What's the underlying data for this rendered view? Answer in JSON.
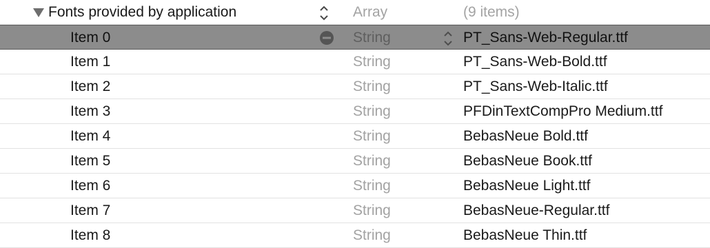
{
  "header": {
    "key": "Fonts provided by application",
    "type": "Array",
    "value": "(9 items)",
    "disclosure_icon": "disclosure-triangle-expanded",
    "stepper_icon": "up-down-chevron"
  },
  "items": [
    {
      "key": "Item 0",
      "type": "String",
      "value": "PT_Sans-Web-Regular.ttf"
    },
    {
      "key": "Item 1",
      "type": "String",
      "value": "PT_Sans-Web-Bold.ttf"
    },
    {
      "key": "Item 2",
      "type": "String",
      "value": "PT_Sans-Web-Italic.ttf"
    },
    {
      "key": "Item 3",
      "type": "String",
      "value": "PFDinTextCompPro Medium.ttf"
    },
    {
      "key": "Item 4",
      "type": "String",
      "value": "BebasNeue Bold.ttf"
    },
    {
      "key": "Item 5",
      "type": "String",
      "value": "BebasNeue Book.ttf"
    },
    {
      "key": "Item 6",
      "type": "String",
      "value": "BebasNeue Light.ttf"
    },
    {
      "key": "Item 7",
      "type": "String",
      "value": "BebasNeue-Regular.ttf"
    },
    {
      "key": "Item 8",
      "type": "String",
      "value": "BebasNeue Thin.ttf"
    }
  ],
  "selected_index": 0,
  "selected_row_icons": {
    "remove": "minus-circle-icon",
    "type_stepper": "up-down-chevron"
  },
  "colors": {
    "selected_row_bg": "#8c8c8c",
    "muted_text": "#a3a3a3",
    "text": "#1a1a1a",
    "separator": "#e2e2e2"
  }
}
